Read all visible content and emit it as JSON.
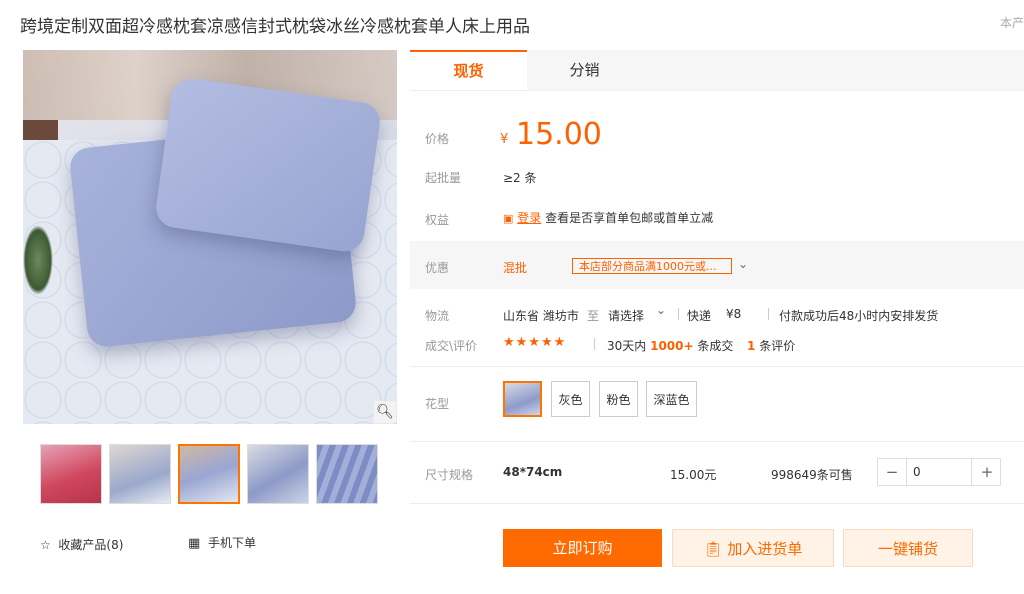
{
  "product": {
    "title": "跨境定制双面超冷感枕套凉感信封式枕袋冰丝冷感枕套单人床上用品",
    "corner_text": "本产"
  },
  "gallery": {
    "zoom_icon": "search-icon",
    "favorite": {
      "icon": "star-outline-icon",
      "label": "收藏产品(8)"
    },
    "mobile_order": {
      "icon": "qr-code-icon",
      "label": "手机下单"
    },
    "thumbnails": [
      {
        "name": "thumb-1"
      },
      {
        "name": "thumb-2"
      },
      {
        "name": "thumb-3",
        "selected": true
      },
      {
        "name": "thumb-4"
      },
      {
        "name": "thumb-5"
      }
    ]
  },
  "tabs": {
    "active": "现货",
    "other": "分销"
  },
  "info": {
    "price_label": "价格",
    "currency": "¥",
    "price": "15.00",
    "moq_label": "起批量",
    "moq_value": "≥2 条",
    "rights_label": "权益",
    "rights_login": "登录",
    "rights_text": "查看是否享首单包邮或首单立减",
    "promo_label": "优惠",
    "promo_type": "混批",
    "promo_text": "本店部分商品满1000元或...",
    "logistics_label": "物流",
    "origin": "山东省 潍坊市",
    "to": "至",
    "destination": "请选择",
    "express": "快递",
    "express_fee": "¥8",
    "shipping_note": "付款成功后48小时内安排发货",
    "deals_label": "成交\\评价",
    "rating_stars": "★★★★★",
    "deals_prefix": "30天内",
    "deals_count": "1000+",
    "deals_suffix": "条成交",
    "reviews_count": "1",
    "reviews_suffix": "条评价"
  },
  "pattern": {
    "label": "花型",
    "options": [
      "灰色",
      "粉色",
      "深蓝色"
    ]
  },
  "size": {
    "label": "尺寸规格",
    "value": "48*74cm",
    "price": "15.00元",
    "stock": "998649条可售",
    "quantity": "0",
    "minus": "−",
    "plus": "+"
  },
  "actions": {
    "order": "立即订购",
    "cart": "加入进货单",
    "distribute": "一键铺货"
  },
  "colors": {
    "accent": "#ff6000"
  }
}
